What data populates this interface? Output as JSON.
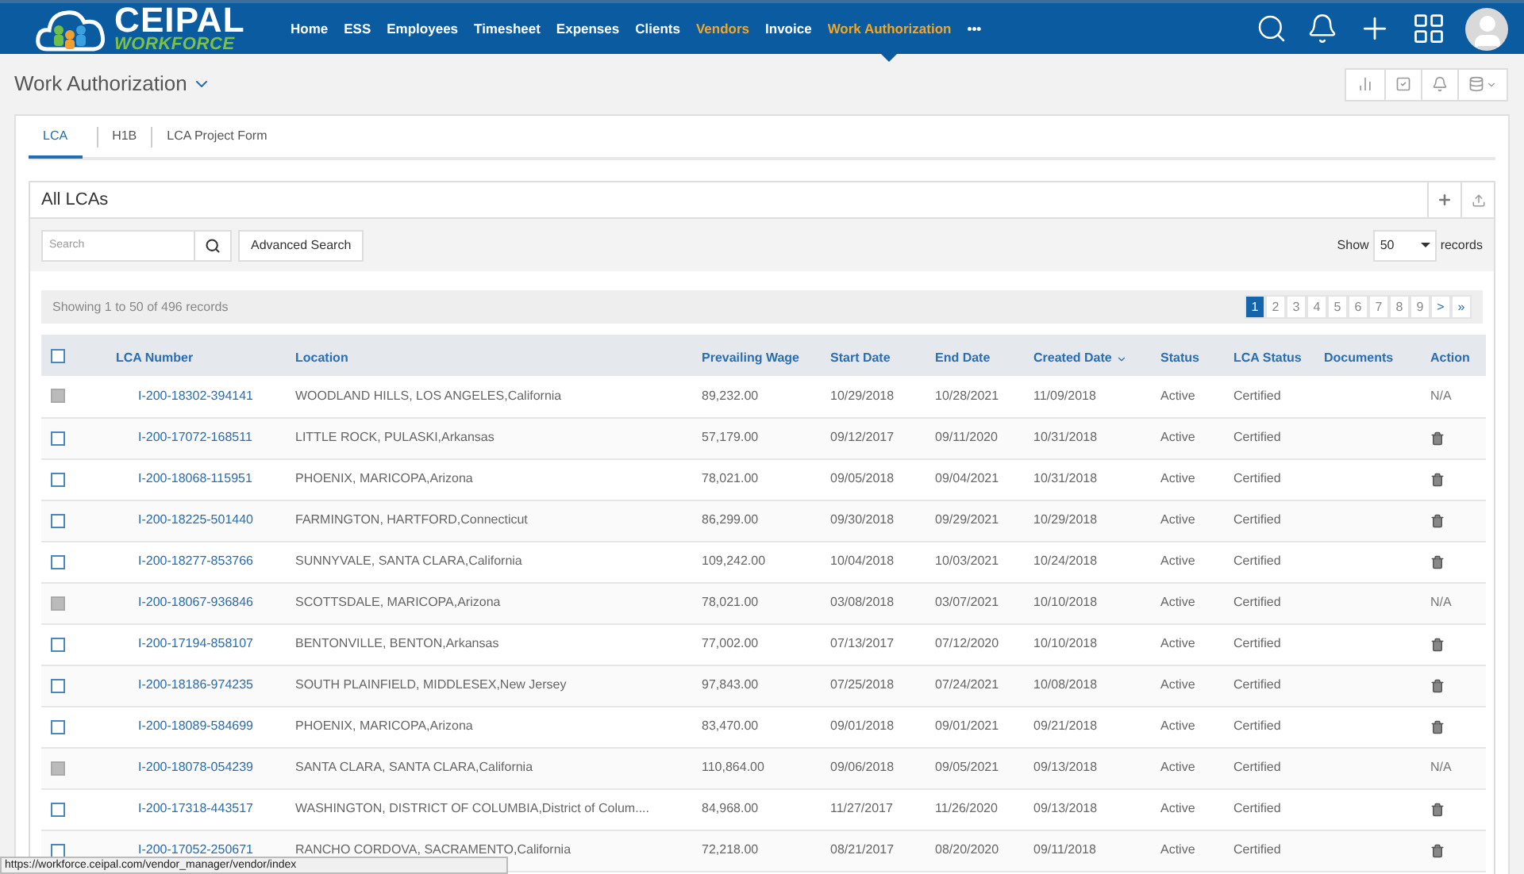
{
  "nav": {
    "logo": {
      "name": "CEIPAL",
      "tagline": "WORKFORCE"
    },
    "items": [
      {
        "label": "Home",
        "active": false,
        "selected": false
      },
      {
        "label": "ESS",
        "active": false,
        "selected": false
      },
      {
        "label": "Employees",
        "active": false,
        "selected": false
      },
      {
        "label": "Timesheet",
        "active": false,
        "selected": false
      },
      {
        "label": "Expenses",
        "active": false,
        "selected": false
      },
      {
        "label": "Clients",
        "active": false,
        "selected": false
      },
      {
        "label": "Vendors",
        "active": true,
        "selected": false
      },
      {
        "label": "Invoice",
        "active": false,
        "selected": false
      },
      {
        "label": "Work Authorization",
        "active": true,
        "selected": true
      },
      {
        "label": "•••",
        "active": false,
        "selected": false
      }
    ]
  },
  "page": {
    "title": "Work Authorization"
  },
  "tabs": [
    {
      "label": "LCA",
      "selected": true
    },
    {
      "label": "H1B",
      "selected": false
    },
    {
      "label": "LCA Project Form",
      "selected": false
    }
  ],
  "panel": {
    "title": "All LCAs",
    "search": {
      "placeholder": "Search"
    },
    "advanced_search": "Advanced Search",
    "show_label": "Show",
    "page_size": "50",
    "records_label": "records"
  },
  "info": "Showing 1 to 50 of 496 records",
  "pagination": [
    {
      "label": "1",
      "selected": true
    },
    {
      "label": "2",
      "selected": false
    },
    {
      "label": "3",
      "selected": false
    },
    {
      "label": "4",
      "selected": false
    },
    {
      "label": "5",
      "selected": false
    },
    {
      "label": "6",
      "selected": false
    },
    {
      "label": "7",
      "selected": false
    },
    {
      "label": "8",
      "selected": false
    },
    {
      "label": "9",
      "selected": false
    },
    {
      "label": ">",
      "selected": false
    },
    {
      "label": "»",
      "selected": false
    }
  ],
  "table": {
    "select_all_checked": false,
    "columns": [
      {
        "label": "LCA Number",
        "sorted": false
      },
      {
        "label": "Location",
        "sorted": false
      },
      {
        "label": "Prevailing Wage",
        "sorted": false
      },
      {
        "label": "Start Date",
        "sorted": false
      },
      {
        "label": "End Date",
        "sorted": false
      },
      {
        "label": "Created Date",
        "sorted": true
      },
      {
        "label": "Status",
        "sorted": false
      },
      {
        "label": "LCA Status",
        "sorted": false
      },
      {
        "label": "Documents",
        "sorted": false
      },
      {
        "label": "Action",
        "sorted": false
      }
    ],
    "rows": [
      {
        "disabled": true,
        "cells": [
          "I-200-18302-394141",
          "WOODLAND HILLS, LOS ANGELES,California",
          "89,232.00",
          "10/29/2018",
          "10/28/2021",
          "11/09/2018",
          "Active",
          "Certified"
        ],
        "action": {
          "kind": "text",
          "label": "N/A"
        }
      },
      {
        "disabled": false,
        "cells": [
          "I-200-17072-168511",
          "LITTLE ROCK, PULASKI,Arkansas",
          "57,179.00",
          "09/12/2017",
          "09/11/2020",
          "10/31/2018",
          "Active",
          "Certified"
        ],
        "action": {
          "kind": "delete"
        }
      },
      {
        "disabled": false,
        "cells": [
          "I-200-18068-115951",
          "PHOENIX, MARICOPA,Arizona",
          "78,021.00",
          "09/05/2018",
          "09/04/2021",
          "10/31/2018",
          "Active",
          "Certified"
        ],
        "action": {
          "kind": "delete"
        }
      },
      {
        "disabled": false,
        "cells": [
          "I-200-18225-501440",
          "FARMINGTON, HARTFORD,Connecticut",
          "86,299.00",
          "09/30/2018",
          "09/29/2021",
          "10/29/2018",
          "Active",
          "Certified"
        ],
        "action": {
          "kind": "delete"
        }
      },
      {
        "disabled": false,
        "cells": [
          "I-200-18277-853766",
          "SUNNYVALE, SANTA CLARA,California",
          "109,242.00",
          "10/04/2018",
          "10/03/2021",
          "10/24/2018",
          "Active",
          "Certified"
        ],
        "action": {
          "kind": "delete"
        }
      },
      {
        "disabled": true,
        "cells": [
          "I-200-18067-936846",
          "SCOTTSDALE, MARICOPA,Arizona",
          "78,021.00",
          "03/08/2018",
          "03/07/2021",
          "10/10/2018",
          "Active",
          "Certified"
        ],
        "action": {
          "kind": "text",
          "label": "N/A"
        }
      },
      {
        "disabled": false,
        "cells": [
          "I-200-17194-858107",
          "BENTONVILLE, BENTON,Arkansas",
          "77,002.00",
          "07/13/2017",
          "07/12/2020",
          "10/10/2018",
          "Active",
          "Certified"
        ],
        "action": {
          "kind": "delete"
        }
      },
      {
        "disabled": false,
        "cells": [
          "I-200-18186-974235",
          "SOUTH PLAINFIELD, MIDDLESEX,New Jersey",
          "97,843.00",
          "07/25/2018",
          "07/24/2021",
          "10/08/2018",
          "Active",
          "Certified"
        ],
        "action": {
          "kind": "delete"
        }
      },
      {
        "disabled": false,
        "cells": [
          "I-200-18089-584699",
          "PHOENIX, MARICOPA,Arizona",
          "83,470.00",
          "09/01/2018",
          "09/01/2021",
          "09/21/2018",
          "Active",
          "Certified"
        ],
        "action": {
          "kind": "delete"
        }
      },
      {
        "disabled": true,
        "cells": [
          "I-200-18078-054239",
          "SANTA CLARA, SANTA CLARA,California",
          "110,864.00",
          "09/06/2018",
          "09/05/2021",
          "09/13/2018",
          "Active",
          "Certified"
        ],
        "action": {
          "kind": "text",
          "label": "N/A"
        }
      },
      {
        "disabled": false,
        "cells": [
          "I-200-17318-443517",
          "WASHINGTON, DISTRICT OF COLUMBIA,District of Colum....",
          "84,968.00",
          "11/27/2017",
          "11/26/2020",
          "09/13/2018",
          "Active",
          "Certified"
        ],
        "action": {
          "kind": "delete"
        }
      },
      {
        "disabled": false,
        "cells": [
          "I-200-17052-250671",
          "RANCHO CORDOVA, SACRAMENTO,California",
          "72,218.00",
          "08/21/2017",
          "08/20/2020",
          "09/11/2018",
          "Active",
          "Certified"
        ],
        "action": {
          "kind": "delete"
        }
      }
    ]
  },
  "status_url": "https://workforce.ceipal.com/vendor_manager/vendor/index"
}
